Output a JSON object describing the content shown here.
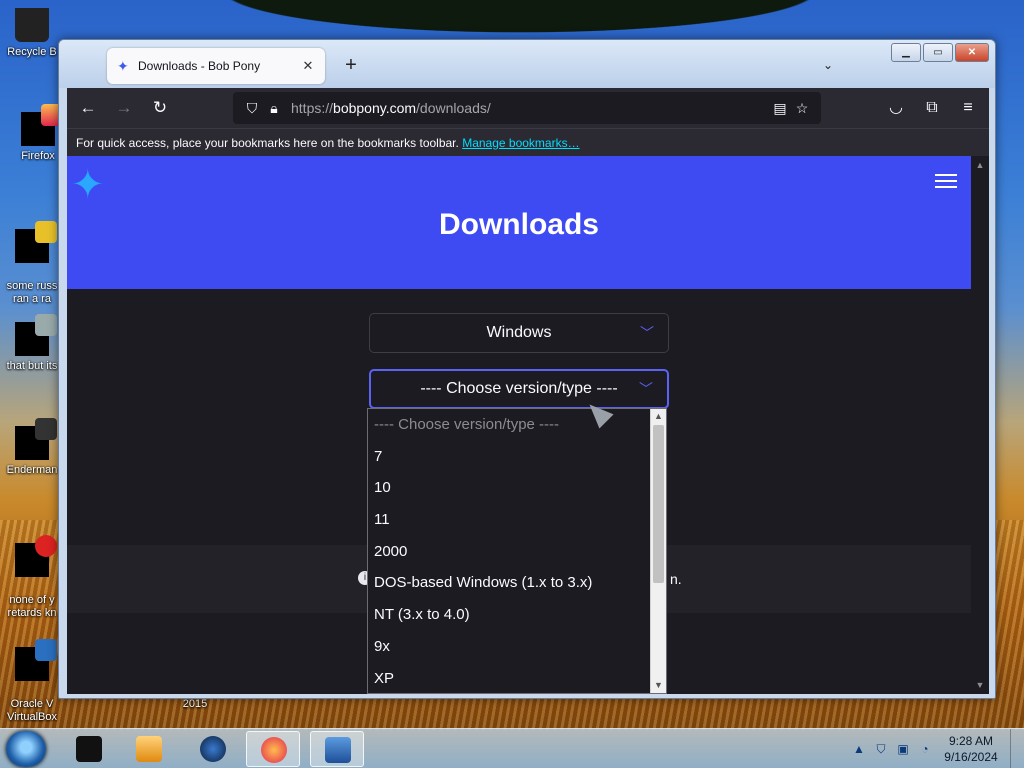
{
  "desktop": {
    "icons": [
      {
        "label": "Recycle Bin",
        "shown": "Recycle B"
      },
      {
        "label": "Firefox",
        "shown": "Firefox"
      },
      {
        "label": "some russ ran a ra",
        "shown": "some russ\nran a ra"
      },
      {
        "label": "that but its",
        "shown": "that but its"
      },
      {
        "label": "Enderman",
        "shown": "Enderman"
      },
      {
        "label": "none of y retards kn",
        "shown": "none of y\nretards kn"
      },
      {
        "label": "Oracle VM VirtualBox",
        "shown": "Oracle V\nVirtualBox"
      }
    ],
    "year_label": "2015"
  },
  "browser": {
    "tab_title": "Downloads - Bob Pony",
    "tab_close": "✕",
    "new_tab": "+",
    "tab_list": "⌄",
    "url_base": "https://",
    "url_host": "bobpony.com",
    "url_path": "/downloads/",
    "bookmarks_hint": "For quick access, place your bookmarks here on the bookmarks toolbar.",
    "bookmarks_link": "Manage bookmarks…"
  },
  "page": {
    "heading": "Downloads",
    "os_select": "Windows",
    "version_select": "---- Choose version/type ----",
    "notice_tail": "n.",
    "notice_badge": "i"
  },
  "dropdown": {
    "options": [
      "---- Choose version/type ----",
      "7",
      "10",
      "11",
      "2000",
      "DOS-based Windows (1.x to 3.x)",
      "NT (3.x to 4.0)",
      "9x",
      "XP"
    ]
  },
  "taskbar": {
    "time": "9:28 AM",
    "date": "9/16/2024",
    "tray_chevron": "▲"
  },
  "colors": {
    "accent": "#5b63f5",
    "hero": "#3f4bf2",
    "page_bg": "#1c1b22",
    "link": "#00ddff"
  }
}
